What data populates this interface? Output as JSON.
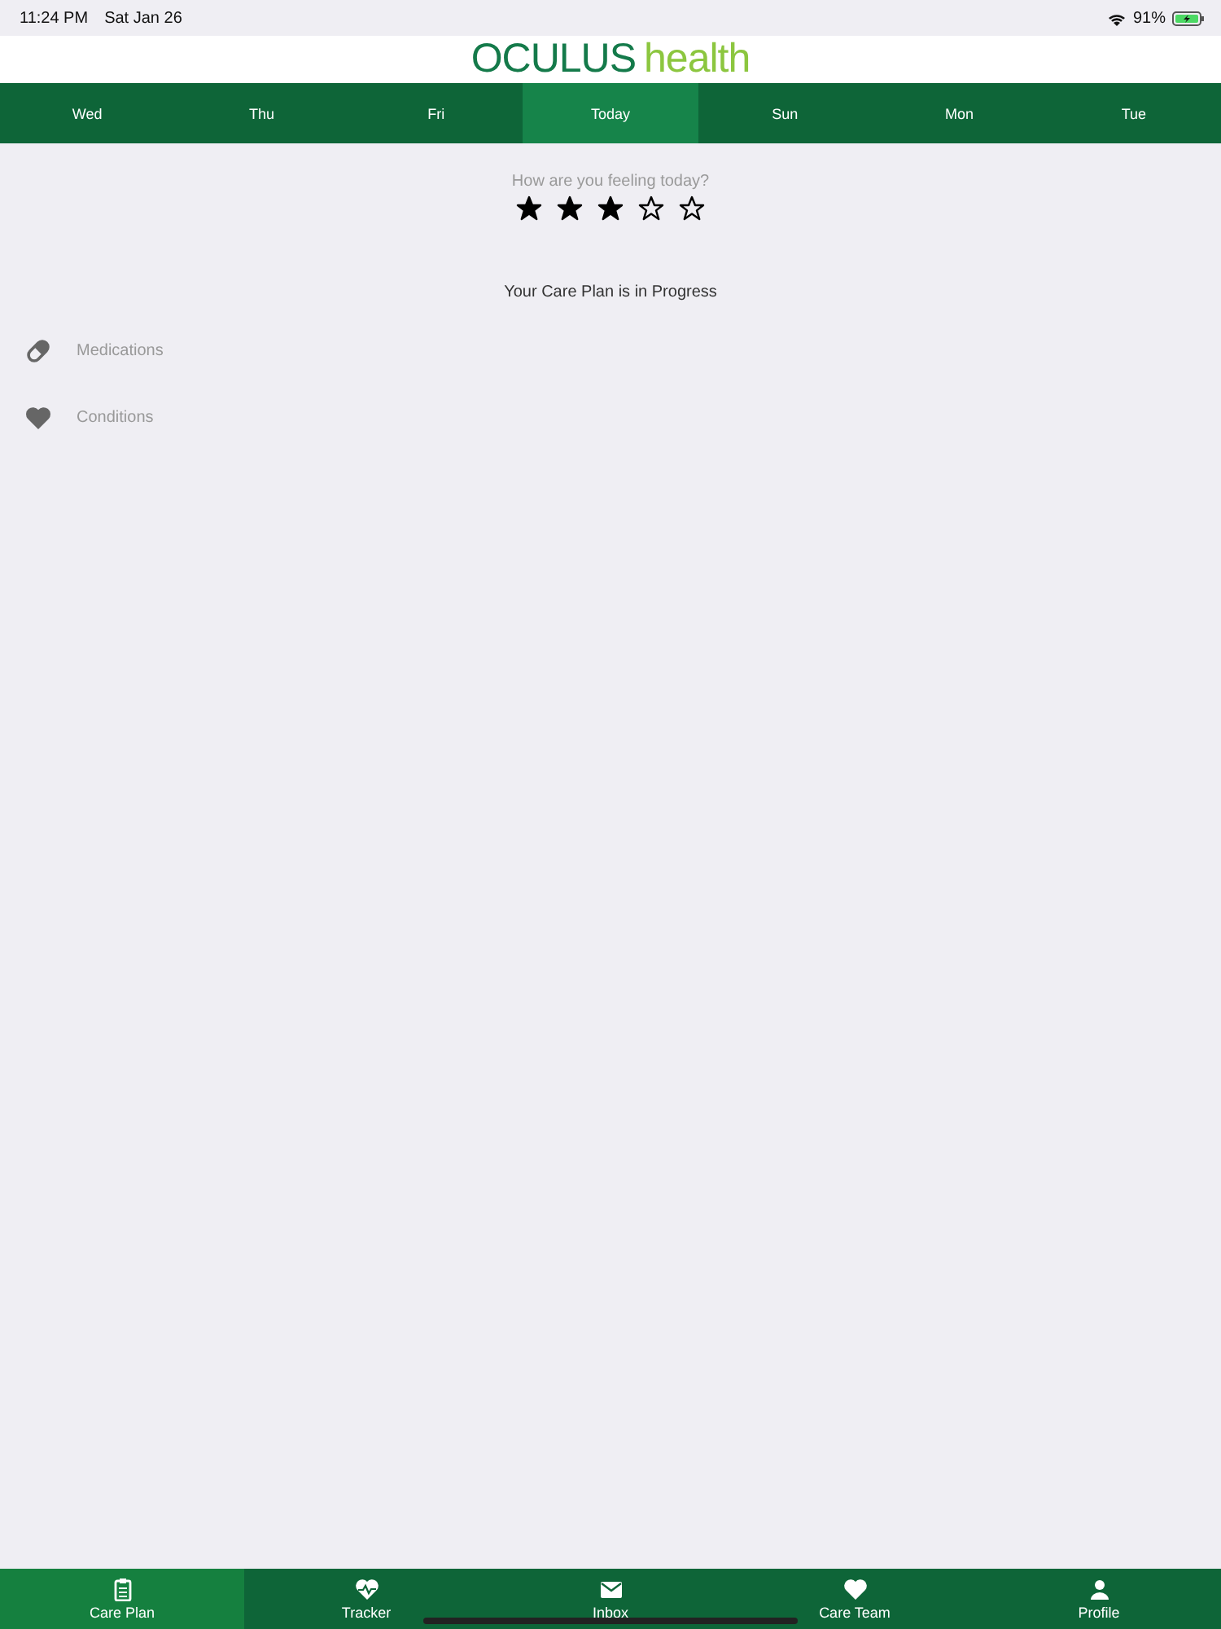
{
  "status_bar": {
    "time": "11:24 PM",
    "date": "Sat Jan 26",
    "battery": "91%"
  },
  "logo": {
    "primary": "OCULUS",
    "secondary": "health"
  },
  "days": [
    {
      "label": "Wed",
      "selected": false
    },
    {
      "label": "Thu",
      "selected": false
    },
    {
      "label": "Fri",
      "selected": false
    },
    {
      "label": "Today",
      "selected": true
    },
    {
      "label": "Sun",
      "selected": false
    },
    {
      "label": "Mon",
      "selected": false
    },
    {
      "label": "Tue",
      "selected": false
    }
  ],
  "mood": {
    "prompt": "How are you feeling today?",
    "stars": 3
  },
  "care_plan_status": "Your Care Plan is in Progress",
  "sections": [
    {
      "label": "Medications",
      "kind": "pill"
    },
    {
      "label": "Conditions",
      "kind": "heart"
    }
  ],
  "tab_bar": [
    {
      "label": "Care Plan",
      "kind": "clipboard",
      "selected": true
    },
    {
      "label": "Tracker",
      "kind": "heartbeat",
      "selected": false
    },
    {
      "label": "Inbox",
      "kind": "mail",
      "selected": false
    },
    {
      "label": "Care Team",
      "kind": "heart",
      "selected": false
    },
    {
      "label": "Profile",
      "kind": "person",
      "selected": false
    }
  ]
}
